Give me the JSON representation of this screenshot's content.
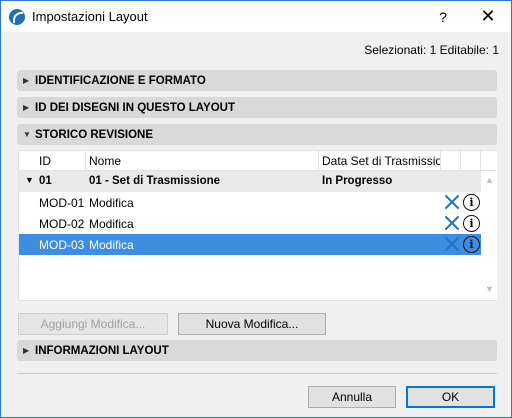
{
  "window": {
    "title": "Impostazioni Layout",
    "help_label": "?",
    "close_label": "✕"
  },
  "selection_info": "Selezionati: 1 Editabile: 1",
  "sections": {
    "identification": "IDENTIFICAZIONE E FORMATO",
    "drawing_ids": "ID DEI DISEGNI IN QUESTO LAYOUT",
    "revision_history": "STORICO REVISIONE",
    "layout_info": "INFORMAZIONI LAYOUT"
  },
  "revision_table": {
    "columns": [
      "ID",
      "Nome",
      "Data Set di Trasmissione"
    ],
    "group": {
      "id": "01",
      "name": "01 - Set di Trasmissione",
      "status": "In Progresso"
    },
    "rows": [
      {
        "id": "MOD-01",
        "name": "Modifica",
        "selected": false
      },
      {
        "id": "MOD-02",
        "name": "Modifica",
        "selected": false
      },
      {
        "id": "MOD-03",
        "name": "Modifica",
        "selected": true
      }
    ]
  },
  "buttons": {
    "add_change": "Aggiungi Modifica...",
    "new_change": "Nuova Modifica...",
    "cancel": "Annulla",
    "ok": "OK"
  },
  "colors": {
    "selection": "#3d8ee0",
    "window_border": "#2b79d6",
    "delete_icon": "#1f72c9"
  }
}
